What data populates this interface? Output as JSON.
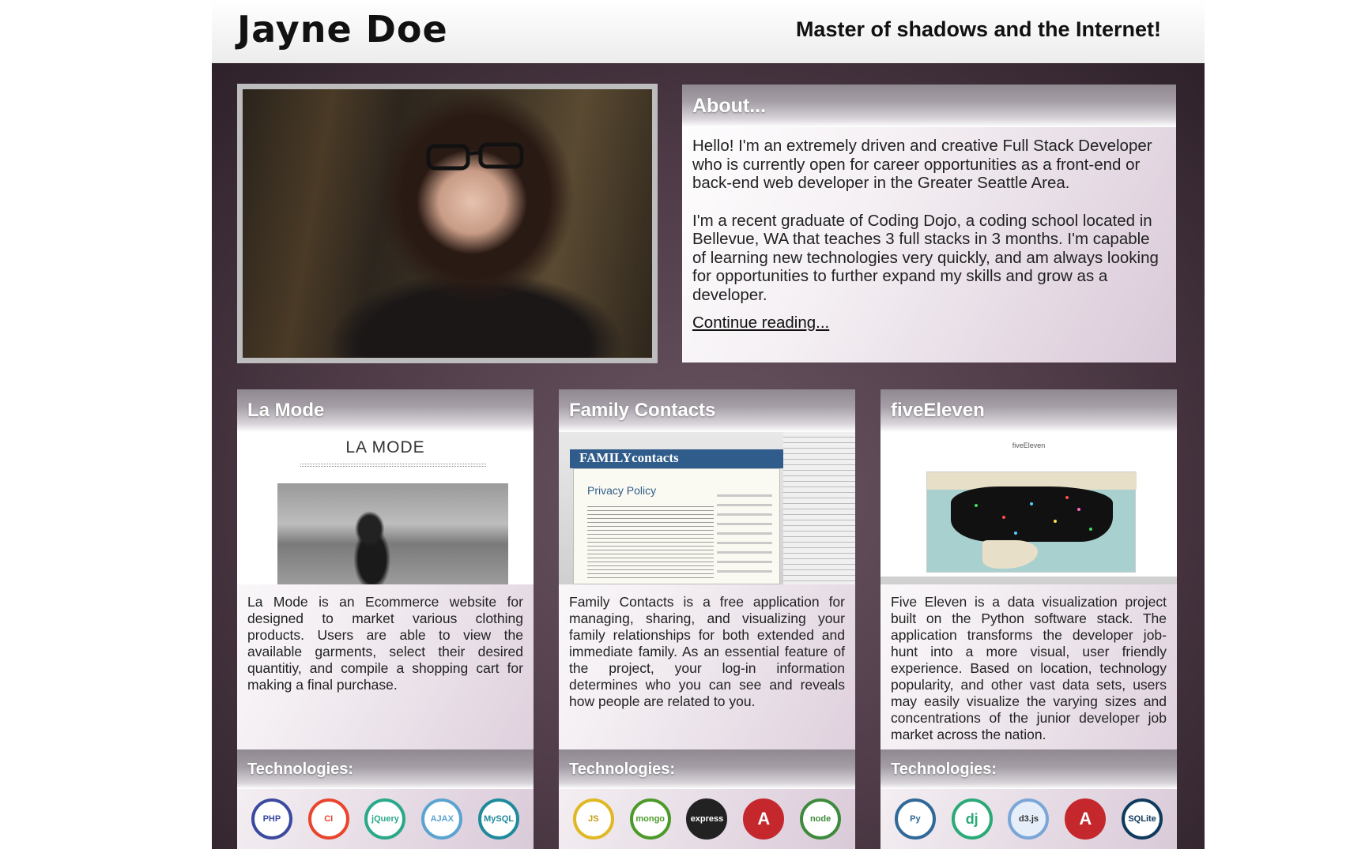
{
  "header": {
    "name": "Jayne Doe",
    "tagline": "Master of shadows and the Internet!"
  },
  "about": {
    "title": "About...",
    "paragraph1": "Hello! I'm an extremely driven and creative Full Stack Developer who is currently open for career opportunities as a front-end or back-end web developer in the Greater Seattle Area.",
    "paragraph2": "I'm a recent graduate of Coding Dojo, a coding school located in Bellevue, WA that teaches 3 full stacks in 3 months. I'm capable of learning new technologies very quickly, and am always looking for opportunities to further expand my skills and grow as a developer.",
    "link": "Continue reading..."
  },
  "projects": [
    {
      "title": "La Mode",
      "screenshot_title": "LA MODE",
      "description": "La Mode is an Ecommerce website for designed to market various clothing products. Users are able to view the available garments, select their desired quantitiy, and compile a shopping cart for making a final purchase.",
      "tech_label": "Technologies:",
      "techs": [
        {
          "icon": "php-icon",
          "label": "PHP",
          "color": "#3b4aa0"
        },
        {
          "icon": "codeigniter-icon",
          "label": "CI",
          "color": "#e8452c"
        },
        {
          "icon": "jquery-icon",
          "label": "jQuery",
          "color": "#2aa88a"
        },
        {
          "icon": "ajax-icon",
          "label": "AJAX",
          "color": "#5ba3d0"
        },
        {
          "icon": "mysql-icon",
          "label": "MySQL",
          "color": "#1f8a9c"
        }
      ]
    },
    {
      "title": "Family Contacts",
      "screenshot_logo": "FAMILYcontacts",
      "screenshot_heading": "Privacy Policy",
      "description": "Family Contacts is a free application for managing, sharing, and visualizing your family relationships for both extended and immediate family. As an essential feature of the project, your log-in information determines who you can see and reveals how people are related to you.",
      "tech_label": "Technologies:",
      "techs": [
        {
          "icon": "javascript-icon",
          "label": "JS",
          "color": "#e0b823"
        },
        {
          "icon": "mongodb-icon",
          "label": "mongo",
          "color": "#4c9a2a"
        },
        {
          "icon": "express-icon",
          "label": "express",
          "color": "#222222"
        },
        {
          "icon": "angular-icon",
          "label": "A",
          "color": "#c4282d"
        },
        {
          "icon": "node-icon",
          "label": "node",
          "color": "#3e8a3c"
        }
      ]
    },
    {
      "title": "fiveEleven",
      "screenshot_title": "fiveEleven",
      "description": "Five Eleven is a data visualization project built on the Python software stack. The application transforms the developer job-hunt into a more visual, user friendly experience. Based on location, technology popularity, and other vast data sets, users may easily visualize the varying sizes and concentrations of the junior developer job market across the nation.",
      "tech_label": "Technologies:",
      "techs": [
        {
          "icon": "python-icon",
          "label": "Py",
          "color": "#306998"
        },
        {
          "icon": "django-icon",
          "label": "dj",
          "color": "#2ba977"
        },
        {
          "icon": "d3-icon",
          "label": "d3.js",
          "color": "#7aa6d8"
        },
        {
          "icon": "angular-icon",
          "label": "A",
          "color": "#c4282d"
        },
        {
          "icon": "sqlite-icon",
          "label": "SQLite",
          "color": "#0f3a5c"
        }
      ]
    }
  ]
}
